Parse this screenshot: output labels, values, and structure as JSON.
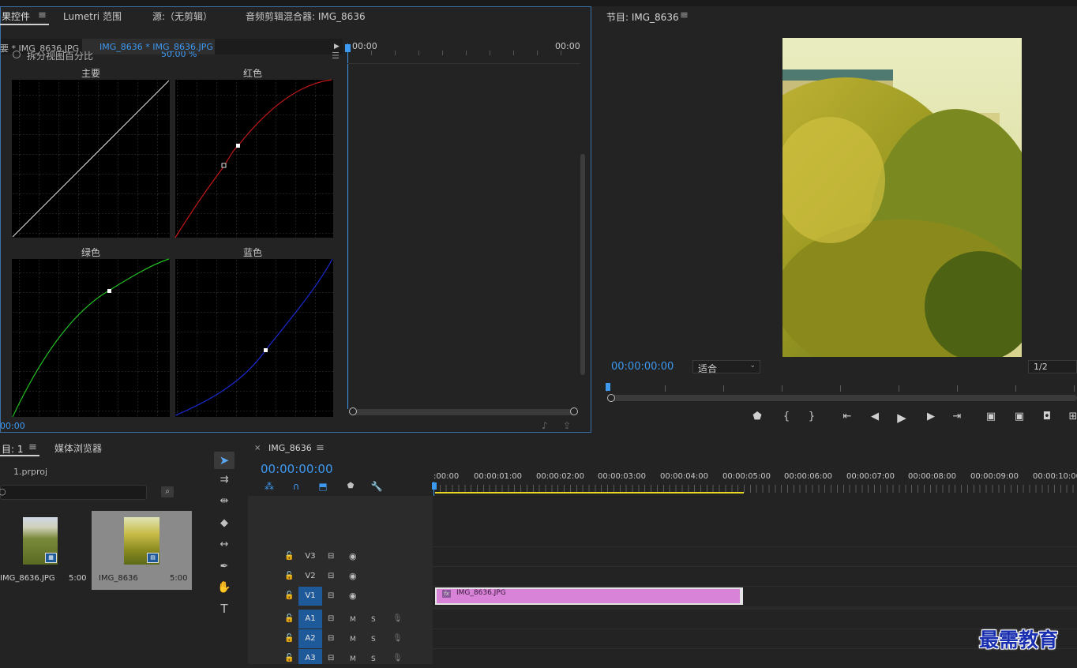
{
  "effects_panel": {
    "tabs": [
      "果控件",
      "Lumetri 范围",
      "源:（无剪辑）",
      "音频剪辑混合器: IMG_8636"
    ],
    "sub_tabs": [
      "要 * IMG_8636.JPG",
      "IMG_8636 * IMG_8636.JPG"
    ],
    "split_view_label": "拆分视图百分比",
    "split_view_value": "50.00 %",
    "curve_labels": [
      "主要",
      "红色",
      "绿色",
      "蓝色"
    ],
    "mini_time_start": "00:00",
    "mini_time_end": "00:00",
    "bottom_time": "00:00"
  },
  "program_monitor": {
    "title": "节目: IMG_8636",
    "timecode": "00:00:00:00",
    "fit_label": "适合",
    "resolution": "1/2"
  },
  "project_panel": {
    "tab_project": "目: 1",
    "tab_media": "媒体浏览器",
    "project_file": "1.prproj",
    "items": [
      {
        "name": "IMG_8636.JPG",
        "duration": "5:00"
      },
      {
        "name": "IMG_8636",
        "duration": "5:00"
      }
    ]
  },
  "timeline": {
    "sequence_name": "IMG_8636",
    "timecode": "00:00:00:00",
    "ruler": [
      ":00:00",
      "00:00:01:00",
      "00:00:02:00",
      "00:00:03:00",
      "00:00:04:00",
      "00:00:05:00",
      "00:00:06:00",
      "00:00:07:00",
      "00:00:08:00",
      "00:00:09:00",
      "00:00:10:00"
    ],
    "video_tracks": [
      "V3",
      "V2",
      "V1"
    ],
    "audio_tracks": [
      "A1",
      "A2",
      "A3"
    ],
    "mute_label": "M",
    "solo_label": "S",
    "clip_name": "IMG_8636.JPG",
    "fx_label": "fx"
  },
  "watermark": "最需教育"
}
